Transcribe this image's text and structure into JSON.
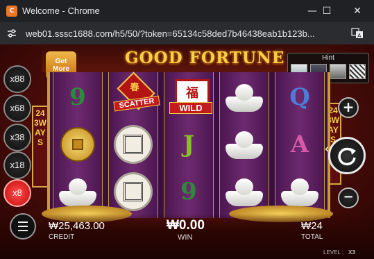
{
  "window": {
    "app_icon": "chrome-app-icon",
    "title": "Welcome - Chrome",
    "controls": {
      "minimize": "—",
      "maximize": "☐",
      "close": "✕"
    }
  },
  "address": {
    "url": "web01.sssc1688.com/h5/50/?token=65134c58ded7b46438eab1b123b...",
    "site_icon": "tune-icon",
    "translate_icon": "translate-icon"
  },
  "game": {
    "logo": "GOOD FORTUNE",
    "get_more": {
      "line1": "Get",
      "line2": "More"
    },
    "hint": {
      "title": "Hint"
    },
    "multipliers": [
      "x88",
      "x68",
      "x38",
      "x18",
      "x8"
    ],
    "active_multiplier": "x8",
    "ways_label": "243WAYS",
    "reels": [
      [
        "9",
        "coin",
        "ingot"
      ],
      [
        "scatter",
        "knot",
        "knot"
      ],
      [
        "wild",
        "J",
        "9"
      ],
      [
        "ingot",
        "ingot",
        "ingot"
      ],
      [
        "Q",
        "A",
        "ingot"
      ]
    ],
    "scatter": {
      "char": "春",
      "label": "SCATTER"
    },
    "wild": {
      "char": "福",
      "label": "WILD"
    },
    "bottom": {
      "credit_value": "₩25,463.00",
      "credit_label": "CREDIT",
      "win_value": "₩0.00",
      "win_label": "WIN",
      "total_value": "₩24",
      "total_label": "TOTAL",
      "level_label": "LEVEL :",
      "level_value": "X3"
    },
    "buttons": {
      "plus": "+",
      "minus": "−",
      "spin_icon": "refresh-icon",
      "menu_icon": "menu-icon",
      "reel_caret": "‹"
    },
    "colors": {
      "accent_gold": "#f7d04a",
      "active_red": "#c40b0b",
      "reel_purple": "#6d2a6e"
    }
  }
}
